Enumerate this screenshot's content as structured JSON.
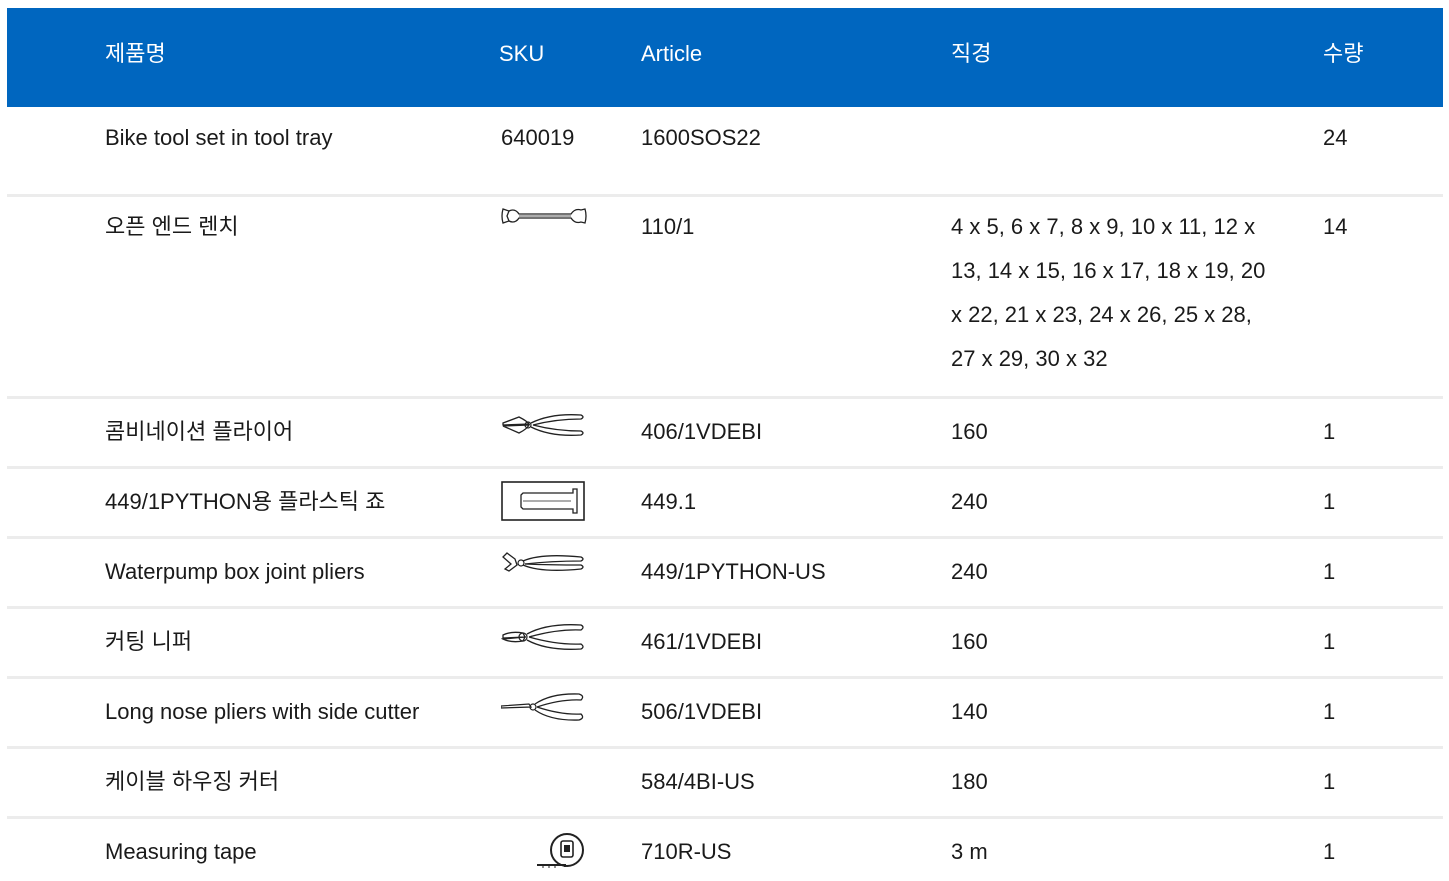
{
  "header": {
    "product_name": "제품명",
    "sku": "SKU",
    "article": "Article",
    "diameter": "직경",
    "quantity": "수량"
  },
  "rows": [
    {
      "name": "Bike tool set in tool tray",
      "sku": "640019",
      "icon": "",
      "article": "1600SOS22",
      "diameter": "",
      "quantity": "24"
    },
    {
      "name": "오픈 엔드 렌치",
      "sku": "",
      "icon": "open-end-wrench-icon",
      "article": "110/1",
      "diameter": "4 x 5, 6 x 7, 8 x 9, 10 x 11, 12 x 13, 14 x 15, 16 x 17, 18 x 19, 20 x 22, 21 x 23, 24 x 26, 25 x 28, 27 x 29, 30 x 32",
      "quantity": "14"
    },
    {
      "name": "콤비네이션 플라이어",
      "sku": "",
      "icon": "combination-pliers-icon",
      "article": "406/1VDEBI",
      "diameter": "160",
      "quantity": "1"
    },
    {
      "name": "449/1PYTHON용 플라스틱 죠",
      "sku": "",
      "icon": "plastic-jaw-icon",
      "article": "449.1",
      "diameter": "240",
      "quantity": "1"
    },
    {
      "name": "Waterpump box joint pliers",
      "sku": "",
      "icon": "waterpump-pliers-icon",
      "article": "449/1PYTHON-US",
      "diameter": "240",
      "quantity": "1"
    },
    {
      "name": "커팅 니퍼",
      "sku": "",
      "icon": "cutting-nipper-icon",
      "article": "461/1VDEBI",
      "diameter": "160",
      "quantity": "1"
    },
    {
      "name": "Long nose pliers with side cutter",
      "sku": "",
      "icon": "long-nose-pliers-icon",
      "article": "506/1VDEBI",
      "diameter": "140",
      "quantity": "1"
    },
    {
      "name": "케이블 하우징 커터",
      "sku": "",
      "icon": "",
      "article": "584/4BI-US",
      "diameter": "180",
      "quantity": "1"
    },
    {
      "name": "Measuring tape",
      "sku": "",
      "icon": "measuring-tape-icon",
      "article": "710R-US",
      "diameter": "3 m",
      "quantity": "1"
    }
  ],
  "colors": {
    "header_bg": "#0066bf",
    "header_text": "#ffffff",
    "row_divider": "#ececec"
  }
}
